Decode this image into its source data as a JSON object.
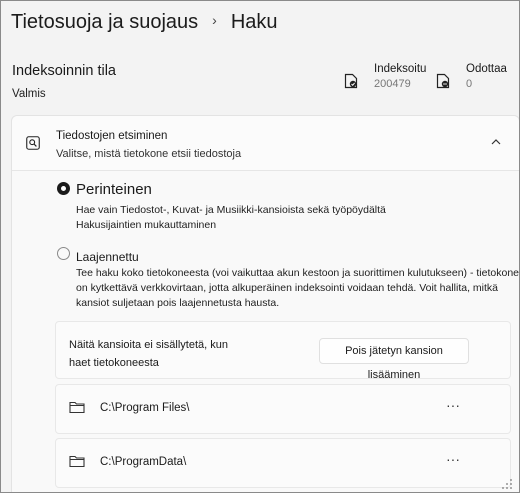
{
  "breadcrumb": {
    "parent": "Tietosuoja ja suojaus",
    "separator": "›",
    "current": "Haku"
  },
  "indexing_status": {
    "title": "Indeksoinnin tila",
    "value": "Valmis",
    "indexed": {
      "label": "Indeksoitu",
      "count": "200479",
      "icon": "document-check-icon"
    },
    "pending": {
      "label": "Odottaa",
      "count": "0",
      "icon": "document-pending-icon"
    }
  },
  "file_search": {
    "icon": "search-icon",
    "title": "Tiedostojen etsiminen",
    "subtitle": "Valitse, mistä tietokone etsii tiedostoja",
    "expanded": true,
    "options": [
      {
        "label": "Perinteinen",
        "selected": true,
        "description_lines": [
          "Hae vain Tiedostot-, Kuvat- ja Musiikki-kansioista sekä työpöydältä",
          "Hakusijaintien mukauttaminen"
        ]
      },
      {
        "label": "Laajennettu",
        "selected": false,
        "description_lines": [
          "Tee haku koko tietokoneesta (voi vaikuttaa akun kestoon ja suorittimen kulutukseen) - tietokone",
          "on kytkettävä verkkovirtaan, jotta alkuperäinen indeksointi voidaan tehdä. Voit hallita, mitkä",
          "kansiot suljetaan pois laajennetusta hausta."
        ]
      }
    ],
    "exclusions": {
      "text_lines": [
        "Näitä kansioita ei sisällytetä, kun",
        "haet tietokoneesta"
      ],
      "add_button_label": "Pois jätetyn kansion lisääminen",
      "folders": [
        {
          "path": "C:\\Program Files\\",
          "icon": "folder-icon",
          "more": "···"
        },
        {
          "path": "C:\\ProgramData\\",
          "icon": "folder-icon",
          "more": "···"
        }
      ]
    }
  }
}
